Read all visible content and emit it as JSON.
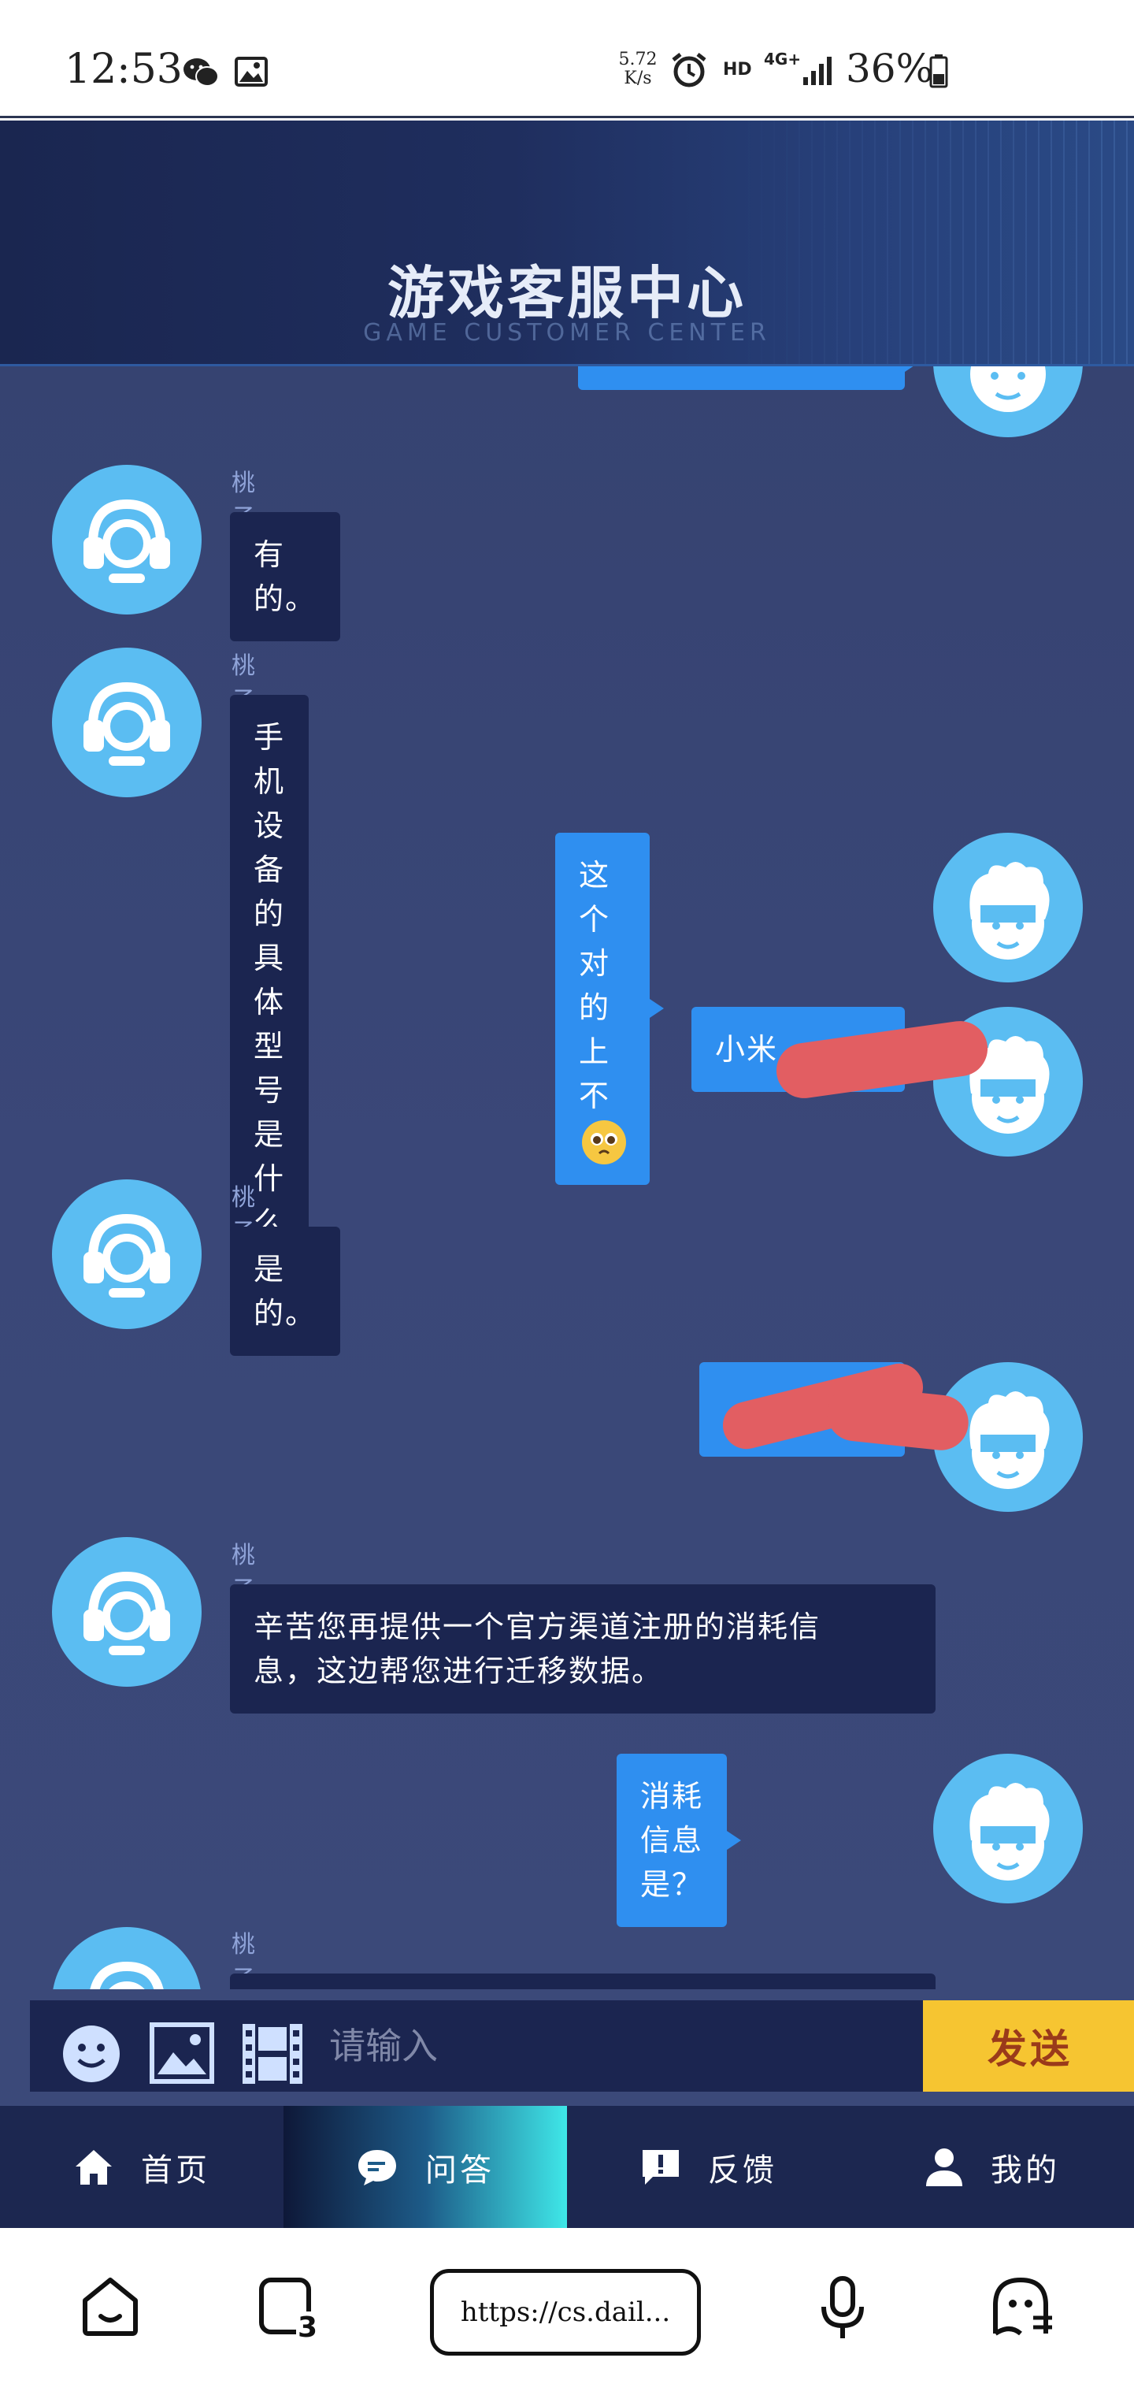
{
  "status_bar": {
    "time": "12:53",
    "net_speed_value": "5.72",
    "net_speed_unit": "K/s",
    "hd": "HD",
    "network": "4G+",
    "battery": "36%"
  },
  "header": {
    "title": "游戏客服中心",
    "subtitle": "GAME CUSTOMER CENTER"
  },
  "chat": {
    "messages": [
      {
        "sender": "agent",
        "name": "桃子姐姐",
        "text": "有的。"
      },
      {
        "sender": "agent",
        "name": "桃子姐姐",
        "text": "手机设备的具体型号是什么呢~"
      },
      {
        "sender": "user",
        "text": "这个对的上不"
      },
      {
        "sender": "user",
        "text": "小米"
      },
      {
        "sender": "agent",
        "name": "桃子姐姐",
        "text": "是的。"
      },
      {
        "sender": "user",
        "text": ""
      },
      {
        "sender": "agent",
        "name": "桃子姐姐",
        "line1": "辛苦您再提供一个官方渠道注册的消耗信",
        "line2": "息，这边帮您进行迁移数据。"
      },
      {
        "sender": "user",
        "text": "消耗信息是？"
      },
      {
        "sender": "agent",
        "name": "桃子姐姐",
        "text": ""
      }
    ]
  },
  "input_bar": {
    "placeholder": "请输入",
    "value": "",
    "send_label": "发送"
  },
  "bottom_nav": {
    "items": [
      {
        "label": "首页",
        "icon": "home-icon"
      },
      {
        "label": "问答",
        "icon": "chat-bubble-icon",
        "active": true
      },
      {
        "label": "反馈",
        "icon": "feedback-icon"
      },
      {
        "label": "我的",
        "icon": "user-icon"
      }
    ]
  },
  "browser_bar": {
    "url": "https://cs.dail...",
    "tab_count": "3"
  },
  "colors": {
    "chat_bg": "#3a4778",
    "agent_bubble": "#1b2550",
    "user_bubble": "#2f8ff0",
    "avatar": "#5bbdf2",
    "send_button": "#f6c531",
    "nav_bg": "#1c2750"
  }
}
